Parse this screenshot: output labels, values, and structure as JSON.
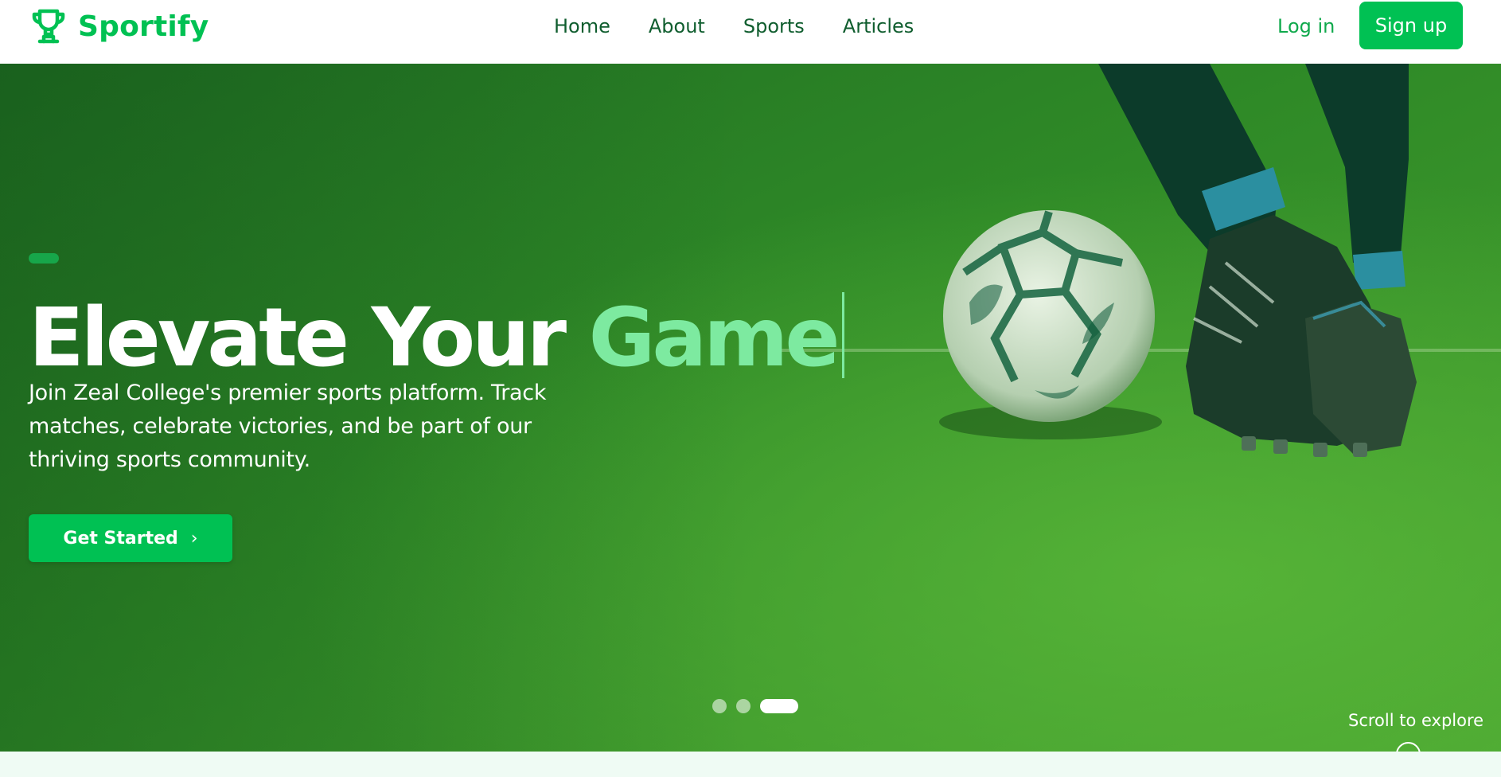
{
  "brand": {
    "name": "Sportify",
    "icon": "trophy-icon",
    "color": "#00c153"
  },
  "nav": {
    "links": [
      "Home",
      "About",
      "Sports",
      "Articles"
    ],
    "login": "Log in",
    "signup": "Sign up"
  },
  "hero": {
    "title_part1": "Elevate Your",
    "title_accent": "Game",
    "subtitle": "Join Zeal College's premier sports platform. Track matches, celebrate victories, and be part of our thriving sports community.",
    "cta_label": "Get Started",
    "cta_icon": "chevron-right-icon",
    "scroll_label": "Scroll to explore",
    "slides_total": 3,
    "slide_active": 3
  },
  "colors": {
    "primary": "#00c153",
    "accent_text": "#7deaa0",
    "nav_text": "#0f5d2e",
    "page_bg": "#effbf4"
  }
}
